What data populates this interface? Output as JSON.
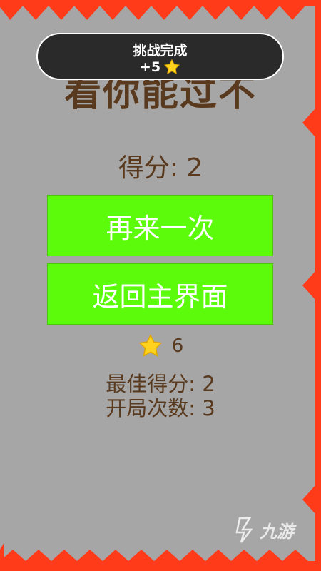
{
  "game": {
    "title_partial": "看你能过不",
    "toast": {
      "title": "挑战完成",
      "reward": "+5",
      "icon": "star-icon"
    },
    "score_text": "得分: 2",
    "buttons": {
      "retry": "再来一次",
      "home": "返回主界面"
    },
    "stars": {
      "icon": "star-icon",
      "count": "6"
    },
    "stats": {
      "best": "最佳得分: 2",
      "plays": "开局次数: 3"
    },
    "watermark": "九游"
  },
  "colors": {
    "background": "#a6a6a6",
    "border_spikes": "#ff3b1a",
    "button": "#5cfb0c",
    "text_brown": "#5a3a1e",
    "toast_bg": "#2a2a2a"
  }
}
